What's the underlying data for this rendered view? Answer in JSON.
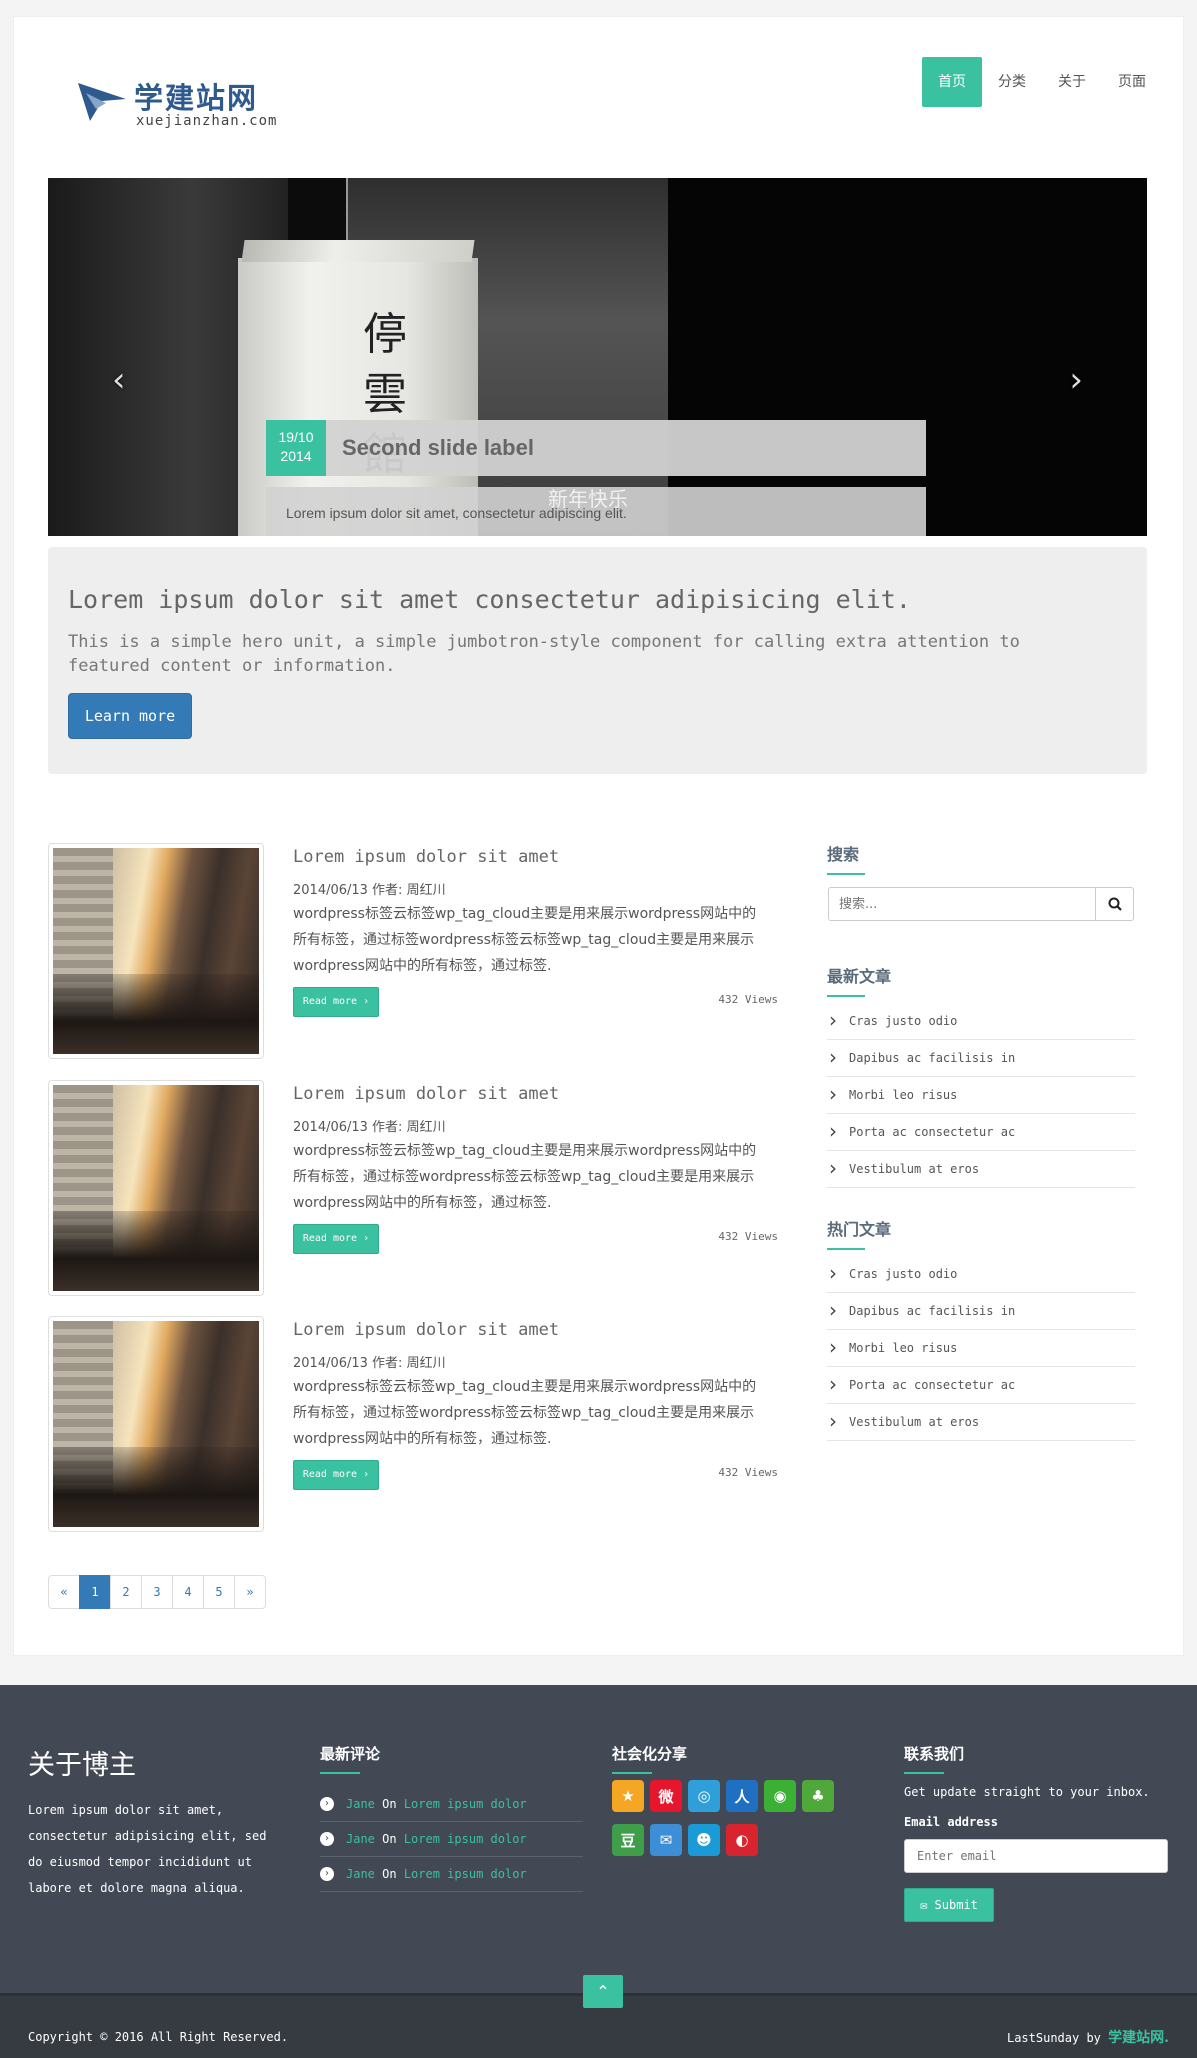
{
  "header": {
    "logo_title": "学建站网",
    "logo_sub": "xuejianzhan.com",
    "nav": [
      "首页",
      "分类",
      "关于",
      "页面"
    ]
  },
  "carousel": {
    "date_day": "19/10",
    "date_year": "2014",
    "title": "Second slide label",
    "desc": "Lorem ipsum dolor sit amet, consectetur adipiscing elit.",
    "overlay_text": "新年快乐",
    "lantern_chars": [
      "停",
      "雲",
      "館"
    ],
    "prev_glyph": "‹",
    "next_glyph": "›"
  },
  "jumbotron": {
    "heading": "Lorem ipsum dolor sit amet consectetur adipisicing elit.",
    "text": "This is a simple hero unit, a simple jumbotron-style component for calling extra attention to featured content or information.",
    "button": "Learn more"
  },
  "posts": [
    {
      "title": "Lorem ipsum dolor sit amet",
      "meta": "2014/06/13 作者: 周红川",
      "excerpt": "wordpress标签云标签wp_tag_cloud主要是用来展示wordpress网站中的所有标签，通过标签wordpress标签云标签wp_tag_cloud主要是用来展示wordpress网站中的所有标签，通过标签.",
      "read_more": "Read more ›",
      "views": "432 Views"
    },
    {
      "title": "Lorem ipsum dolor sit amet",
      "meta": "2014/06/13 作者: 周红川",
      "excerpt": "wordpress标签云标签wp_tag_cloud主要是用来展示wordpress网站中的所有标签，通过标签wordpress标签云标签wp_tag_cloud主要是用来展示wordpress网站中的所有标签，通过标签.",
      "read_more": "Read more ›",
      "views": "432 Views"
    },
    {
      "title": "Lorem ipsum dolor sit amet",
      "meta": "2014/06/13 作者: 周红川",
      "excerpt": "wordpress标签云标签wp_tag_cloud主要是用来展示wordpress网站中的所有标签，通过标签wordpress标签云标签wp_tag_cloud主要是用来展示wordpress网站中的所有标签，通过标签.",
      "read_more": "Read more ›",
      "views": "432 Views"
    }
  ],
  "pagination": [
    "«",
    "1",
    "2",
    "3",
    "4",
    "5",
    "»"
  ],
  "pagination_active": "1",
  "sidebar": {
    "search_title": "搜索",
    "search_placeholder": "搜索...",
    "latest_title": "最新文章",
    "latest": [
      "Cras justo odio",
      "Dapibus ac facilisis in",
      "Morbi leo risus",
      "Porta ac consectetur ac",
      "Vestibulum at eros"
    ],
    "popular_title": "热门文章",
    "popular": [
      "Cras justo odio",
      "Dapibus ac facilisis in",
      "Morbi leo risus",
      "Porta ac consectetur ac",
      "Vestibulum at eros"
    ]
  },
  "footer": {
    "about_title": "关于博主",
    "about_text": "Lorem ipsum dolor sit amet, consectetur adipisicing elit, sed do eiusmod tempor incididunt ut labore et dolore magna aliqua.",
    "comments_title": "最新评论",
    "comments": [
      {
        "who": "Jane",
        "on": "On",
        "what": "Lorem ipsum dolor"
      },
      {
        "who": "Jane",
        "on": "On",
        "what": "Lorem ipsum dolor"
      },
      {
        "who": "Jane",
        "on": "On",
        "what": "Lorem ipsum dolor"
      }
    ],
    "share_title": "社会化分享",
    "share_icons": [
      {
        "name": "qzone-icon",
        "glyph": "★",
        "color": "#f5a623"
      },
      {
        "name": "weibo-icon",
        "glyph": "微",
        "color": "#e6162d"
      },
      {
        "name": "tencent-weibo-icon",
        "glyph": "◎",
        "color": "#2e9fd8"
      },
      {
        "name": "renren-icon",
        "glyph": "人",
        "color": "#1f6fc2"
      },
      {
        "name": "wechat-icon",
        "glyph": "◉",
        "color": "#3cb034"
      },
      {
        "name": "kaixin-icon",
        "glyph": "♣",
        "color": "#4ea83a"
      },
      {
        "name": "douban-icon",
        "glyph": "豆",
        "color": "#3f9e4a"
      },
      {
        "name": "mail-icon",
        "glyph": "✉",
        "color": "#3c8fd6"
      },
      {
        "name": "qq-icon",
        "glyph": "☻",
        "color": "#1a9ad6"
      },
      {
        "name": "netease-icon",
        "glyph": "◐",
        "color": "#d9232e"
      }
    ],
    "contact_title": "联系我们",
    "contact_text": "Get update straight to your inbox.",
    "email_label": "Email address",
    "email_placeholder": "Enter email",
    "submit": "✉ Submit",
    "to_top": "⌃"
  },
  "bottom": {
    "copyright": "Copyright © 2016 All Right Reserved.",
    "credit_prefix": "LastSunday by",
    "credit_brand": "学建站网."
  }
}
